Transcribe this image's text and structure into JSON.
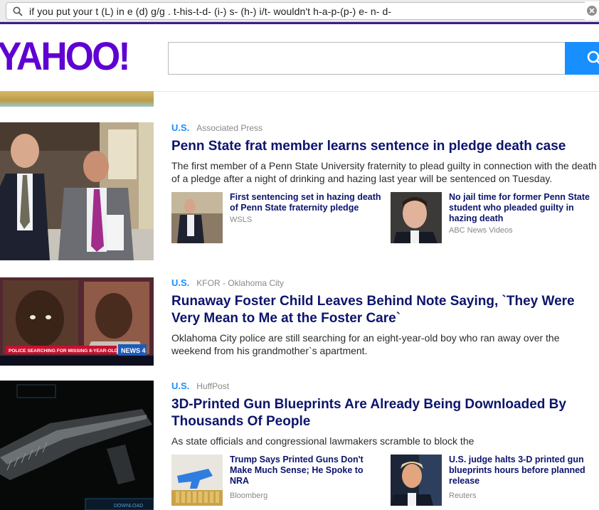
{
  "browser": {
    "url_text": "if you put your t (L) in e (d) g/g . t-his-t-d- (i-) s- (h-) i/t- wouldn't h-a-p-(p-) e- n- d-"
  },
  "header": {
    "logo_text": "YAHOO!",
    "search_placeholder": "",
    "brand_color": "#5f01d1",
    "accent_color": "#188fff"
  },
  "stories": [
    {
      "category": "U.S.",
      "source": "Associated Press",
      "headline": "Penn State frat member learns sentence in pledge death case",
      "summary": "The first member of a Penn State University fraternity to plead guilty in connection with the death of a pledge after a night of drinking and hazing last year will be sentenced on Tuesday.",
      "related": [
        {
          "title": "First sentencing set in hazing death of Penn State fraternity pledge",
          "source": "WSLS"
        },
        {
          "title": "No jail time for former Penn State student who pleaded guilty in hazing death",
          "source": "ABC News Videos"
        }
      ]
    },
    {
      "category": "U.S.",
      "source": "KFOR - Oklahoma City",
      "headline": "Runaway Foster Child Leaves Behind Note Saying, `They Were Very Mean to Me at the Foster Care`",
      "summary": "Oklahoma City police are still searching for an eight-year-old boy who ran away over the weekend from his grandmother`s apartment.",
      "image_caption": "POLICE SEARCHING FOR MISSING 8-YEAR-OLD BOY",
      "image_logo": "NEWS 4"
    },
    {
      "category": "U.S.",
      "source": "HuffPost",
      "headline": "3D-Printed Gun Blueprints Are Already Being Downloaded By Thousands Of People",
      "summary": "As state officials and congressional lawmakers scramble to block the",
      "image_caption": "DOWNLOAD",
      "related": [
        {
          "title": "Trump Says Printed Guns Don't Make Much Sense; He Spoke to NRA",
          "source": "Bloomberg"
        },
        {
          "title": "U.S. judge halts 3-D printed gun blueprints hours before planned release",
          "source": "Reuters"
        }
      ]
    }
  ]
}
